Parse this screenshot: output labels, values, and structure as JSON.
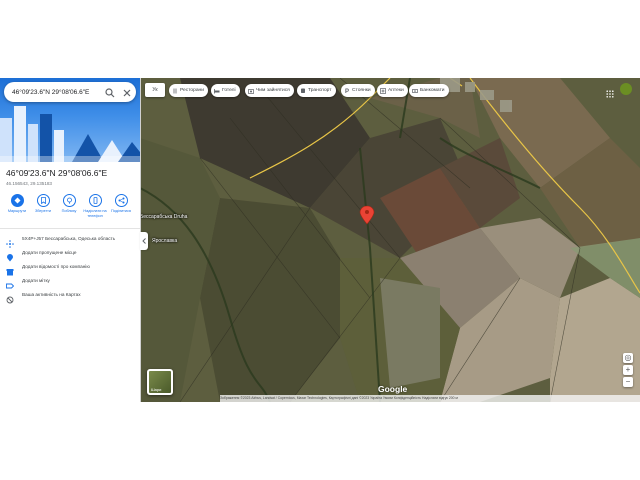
{
  "search": {
    "value": "46°09'23.6\"N 29°08'06.6\"E"
  },
  "place": {
    "title": "46°09'23.6\"N 29°08'06.6\"E",
    "coords": "46.156543, 29.135183"
  },
  "actions": [
    {
      "label": "Маршрути",
      "icon": "directions-icon"
    },
    {
      "label": "Зберегти",
      "icon": "bookmark-icon"
    },
    {
      "label": "Поблизу",
      "icon": "nearby-icon"
    },
    {
      "label": "Надіслати на телефон",
      "icon": "send-to-phone-icon"
    },
    {
      "label": "Поділитися",
      "icon": "share-icon"
    }
  ],
  "info_rows": [
    {
      "text": "5X4P+J57 Бессарабська, Одеська область",
      "icon": "plus-code-icon"
    },
    {
      "text": "Додати пропущене місце",
      "icon": "add-place-icon"
    },
    {
      "text": "Додати відомості про компанію",
      "icon": "business-icon"
    },
    {
      "text": "Додати мітку",
      "icon": "label-icon"
    },
    {
      "text": "Ваша активність на Картах",
      "icon": "history-icon"
    }
  ],
  "map": {
    "lang_label": "Ук",
    "chips": [
      {
        "label": "Ресторани",
        "icon": "fork-knife-icon"
      },
      {
        "label": "Готелі",
        "icon": "bed-icon"
      },
      {
        "label": "Чим зайнятися",
        "icon": "camera-icon"
      },
      {
        "label": "Транспорт",
        "icon": "bus-icon"
      },
      {
        "label": "Стоянки",
        "icon": "parking-icon"
      },
      {
        "label": "Аптеки",
        "icon": "pharmacy-icon"
      },
      {
        "label": "Банкомати",
        "icon": "atm-icon"
      }
    ],
    "places": [
      "Бессарабська Druha",
      "Ярославка"
    ],
    "layers_label": "Шари",
    "logo": "Google",
    "footer": "Зображення ©2023 Airbus, Landsat / Copernicus, Maxar Technologies, Картографічні дані ©2023   Україна   Умови   Конфіденційність   Надіслати відгук   200 м"
  },
  "colors": {
    "accent": "#1a73e8",
    "pin": "#ea4335"
  }
}
